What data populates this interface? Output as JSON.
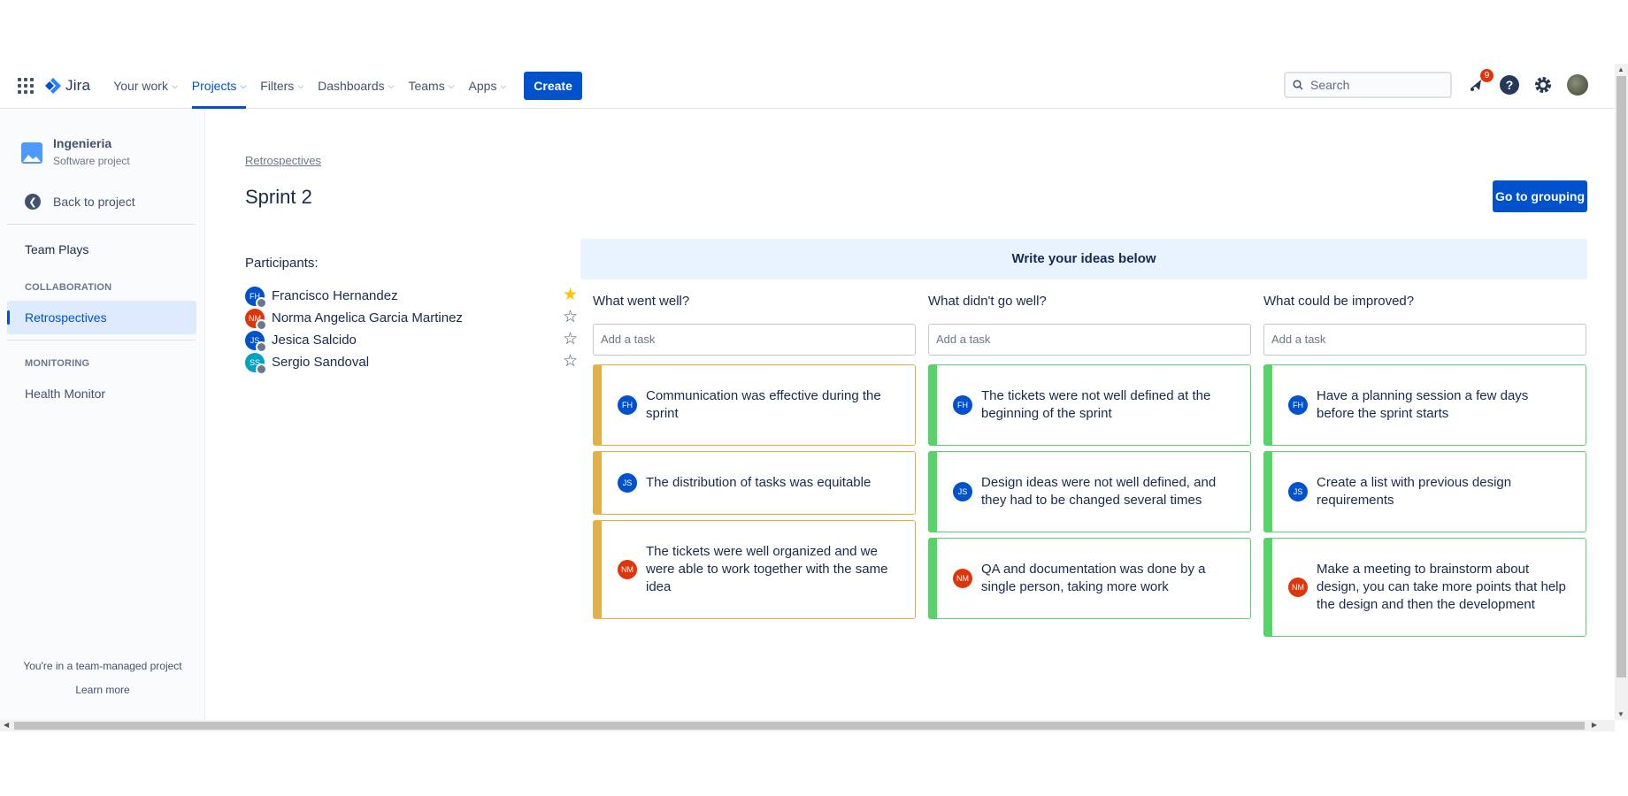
{
  "topnav": {
    "app_name": "Jira",
    "items": [
      {
        "label": "Your work"
      },
      {
        "label": "Projects"
      },
      {
        "label": "Filters"
      },
      {
        "label": "Dashboards"
      },
      {
        "label": "Teams"
      },
      {
        "label": "Apps"
      }
    ],
    "create_label": "Create",
    "search_placeholder": "Search",
    "notification_count": "9"
  },
  "sidebar": {
    "project_name": "Ingenieria",
    "project_type": "Software project",
    "back_label": "Back to project",
    "team_plays": "Team Plays",
    "collaboration_heading": "COLLABORATION",
    "retrospectives": "Retrospectives",
    "monitoring_heading": "MONITORING",
    "health_monitor": "Health Monitor",
    "footer_text": "You're in a team-managed project",
    "learn_more": "Learn more"
  },
  "page": {
    "breadcrumb": "Retrospectives",
    "title": "Sprint 2",
    "grouping_button": "Go to grouping",
    "participants_label": "Participants:"
  },
  "participants": [
    {
      "initials": "FH",
      "name": "Francisco Hernandez",
      "color": "#0052cc",
      "starred": true
    },
    {
      "initials": "NM",
      "name": "Norma Angelica Garcia Martinez",
      "color": "#de350b",
      "starred": false
    },
    {
      "initials": "JS",
      "name": "Jesica Salcido",
      "color": "#0052cc",
      "starred": false
    },
    {
      "initials": "SS",
      "name": "Sergio Sandoval",
      "color": "#00a3bf",
      "starred": false
    }
  ],
  "board": {
    "header": "Write your ideas below",
    "add_task_placeholder": "Add a task",
    "columns": [
      {
        "title": "What went well?",
        "cards": [
          {
            "initials": "FH",
            "text": "Communication was effective during the sprint"
          },
          {
            "initials": "JS",
            "text": "The distribution of tasks was equitable"
          },
          {
            "initials": "NM",
            "text": "The tickets were well organized and we were able to work together with the same idea"
          }
        ]
      },
      {
        "title": "What didn't go well?",
        "cards": [
          {
            "initials": "FH",
            "text": "The tickets were not well defined at the beginning of the sprint"
          },
          {
            "initials": "JS",
            "text": "Design ideas were not well defined, and they had to be changed several times"
          },
          {
            "initials": "NM",
            "text": "QA and documentation was done by a single person, taking more work"
          }
        ]
      },
      {
        "title": "What could be improved?",
        "cards": [
          {
            "initials": "FH",
            "text": "Have a planning session a few days before the sprint starts"
          },
          {
            "initials": "JS",
            "text": "Create a list with previous design requirements"
          },
          {
            "initials": "NM",
            "text": "Make a meeting to brainstorm about design, you can take more points that help the design and then the development"
          }
        ]
      }
    ]
  },
  "colors": {
    "accent": "#0052cc",
    "went_well": "#e2b04a",
    "didnt_go_well": "#57d36a",
    "improve": "#57d36a",
    "fh": "#0052cc",
    "js": "#0052cc",
    "nm": "#de350b"
  }
}
